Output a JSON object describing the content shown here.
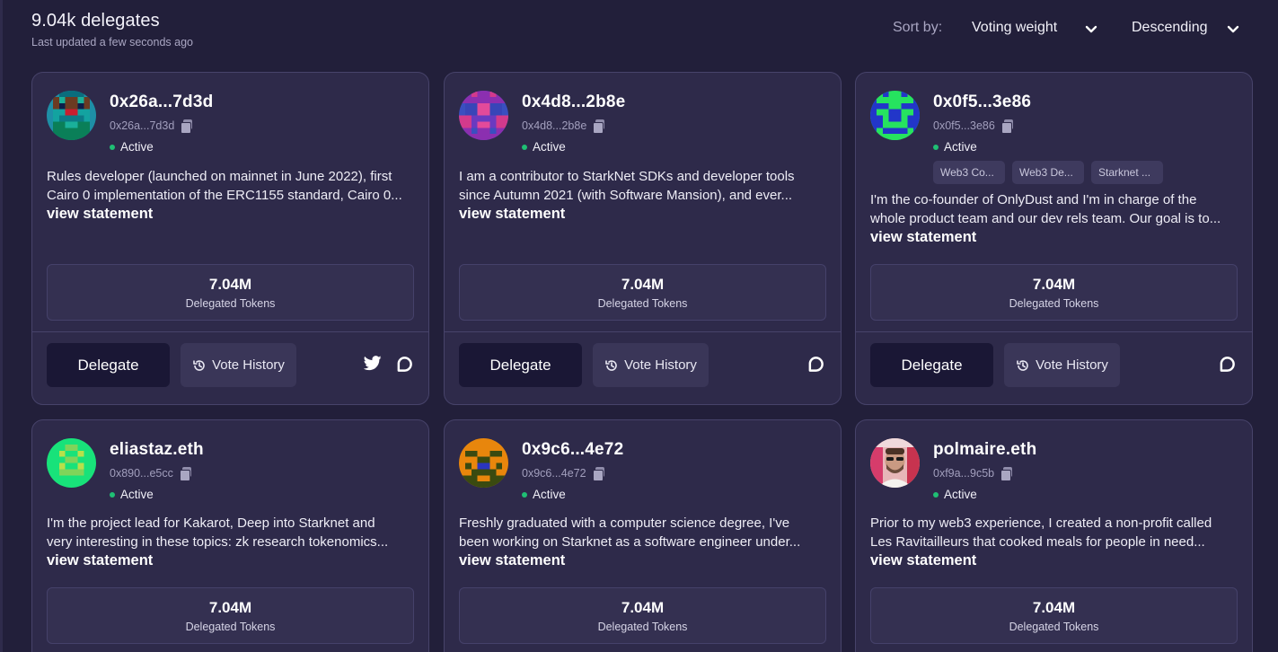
{
  "header": {
    "count": "9.04k delegates",
    "updated": "Last updated a few seconds ago"
  },
  "sort": {
    "label": "Sort by:",
    "field": "Voting weight",
    "order": "Descending"
  },
  "buttons": {
    "delegate": "Delegate",
    "vote_history": "Vote History",
    "view_statement": "view statement"
  },
  "delegates": [
    {
      "name": "0x26a...7d3d",
      "address": "0x26a...7d3d",
      "status": "Active",
      "desc1": "Rules developer (launched on mainnet in June 2022), first",
      "desc2": "Cairo 0 implementation of the ERC1155 standard, Cairo 0...",
      "tokens": "7.04M",
      "tokens_label": "Delegated Tokens",
      "avatar": "pixel-identicon",
      "socials": [
        "twitter-icon",
        "discourse-icon"
      ]
    },
    {
      "name": "0x4d8...2b8e",
      "address": "0x4d8...2b8e",
      "status": "Active",
      "desc1": "I am a contributor to StarkNet SDKs and developer tools",
      "desc2": "since Autumn 2021 (with Software Mansion), and ever...",
      "tokens": "7.04M",
      "tokens_label": "Delegated Tokens",
      "avatar": "pixel-identicon",
      "socials": [
        "discourse-icon"
      ]
    },
    {
      "name": "0x0f5...3e86",
      "address": "0x0f5...3e86",
      "status": "Active",
      "tags": [
        "Web3 Co...",
        "Web3 De...",
        "Starknet ..."
      ],
      "desc1": "I'm the co-founder of OnlyDust and I'm in charge of the",
      "desc2": "whole product team and our dev rels team. Our goal is to...",
      "tokens": "7.04M",
      "tokens_label": "Delegated Tokens",
      "avatar": "pixel-identicon",
      "socials": [
        "discourse-icon"
      ]
    },
    {
      "name": "eliastaz.eth",
      "address": "0x890...e5cc",
      "status": "Active",
      "desc1": "I'm the project lead for Kakarot, Deep into Starknet and",
      "desc2": "very interesting in these topics: zk research tokenomics...",
      "tokens": "7.04M",
      "tokens_label": "Delegated Tokens",
      "avatar": "pixel-identicon"
    },
    {
      "name": "0x9c6...4e72",
      "address": "0x9c6...4e72",
      "status": "Active",
      "desc1": "Freshly graduated with a computer science degree, I've",
      "desc2": "been working on Starknet as a software engineer under...",
      "tokens": "7.04M",
      "tokens_label": "Delegated Tokens",
      "avatar": "pixel-identicon"
    },
    {
      "name": "polmaire.eth",
      "address": "0xf9a...9c5b",
      "status": "Active",
      "desc1": "Prior to my web3 experience, I created a non-profit called",
      "desc2": "Les Ravitailleurs that cooked meals for people in need...",
      "tokens": "7.04M",
      "tokens_label": "Delegated Tokens",
      "avatar": "profile-photo"
    }
  ],
  "colors": {
    "background": "#221f3a",
    "card": "#2e2a4a",
    "active_dot": "#1fbf74",
    "delegate_button": "#1a1735"
  }
}
